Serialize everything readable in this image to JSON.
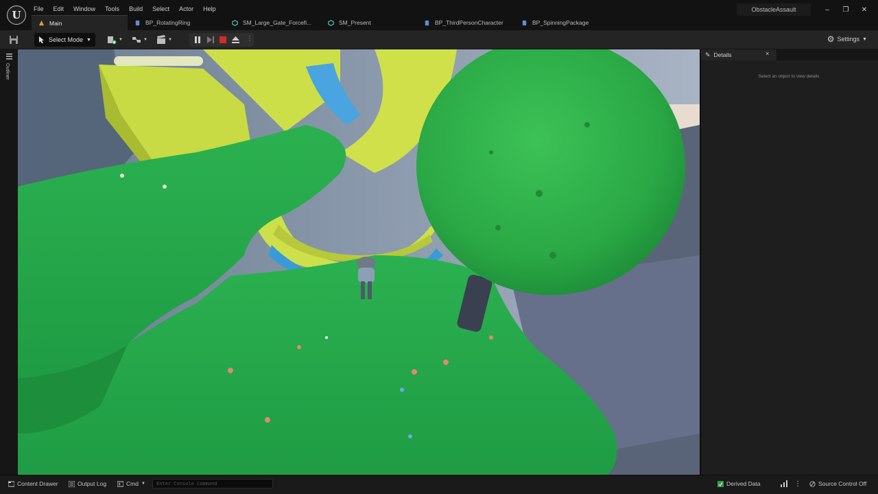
{
  "menu": [
    "File",
    "Edit",
    "Window",
    "Tools",
    "Build",
    "Select",
    "Actor",
    "Help"
  ],
  "project_name": "ObstacleAssault",
  "tabs": [
    {
      "label": "Main",
      "icon": "level-icon",
      "color": "#e0a030"
    },
    {
      "label": "BP_RotatingRing",
      "icon": "blueprint-icon",
      "color": "#5b8fd6"
    },
    {
      "label": "SM_Large_Gate_Forcefi...",
      "icon": "static-mesh-icon",
      "color": "#3fb8a8"
    },
    {
      "label": "SM_Present",
      "icon": "static-mesh-icon",
      "color": "#3fb8a8"
    },
    {
      "label": "BP_ThirdPersonCharacter",
      "icon": "blueprint-icon",
      "color": "#5b8fd6"
    },
    {
      "label": "BP_SpinningPackage",
      "icon": "blueprint-icon",
      "color": "#5b8fd6"
    }
  ],
  "toolbar": {
    "select_mode": "Select Mode",
    "settings": "Settings"
  },
  "left_panel": {
    "outliner": "Outliner"
  },
  "details": {
    "title": "Details",
    "close": "×",
    "empty_message": "Select an object to view details"
  },
  "statusbar": {
    "content_drawer": "Content Drawer",
    "output_log": "Output Log",
    "cmd": "Cmd",
    "console_placeholder": "Enter Console Command",
    "derived_data": "Derived Data",
    "source_control": "Source Control Off"
  },
  "colors": {
    "grass": "#24a84a",
    "ring_yellow": "#cfe04a",
    "ring_blue": "#3a9ad8",
    "tree_green": "#2fb54a",
    "rock": "#5a6578",
    "stop_red": "#d42a2a"
  }
}
